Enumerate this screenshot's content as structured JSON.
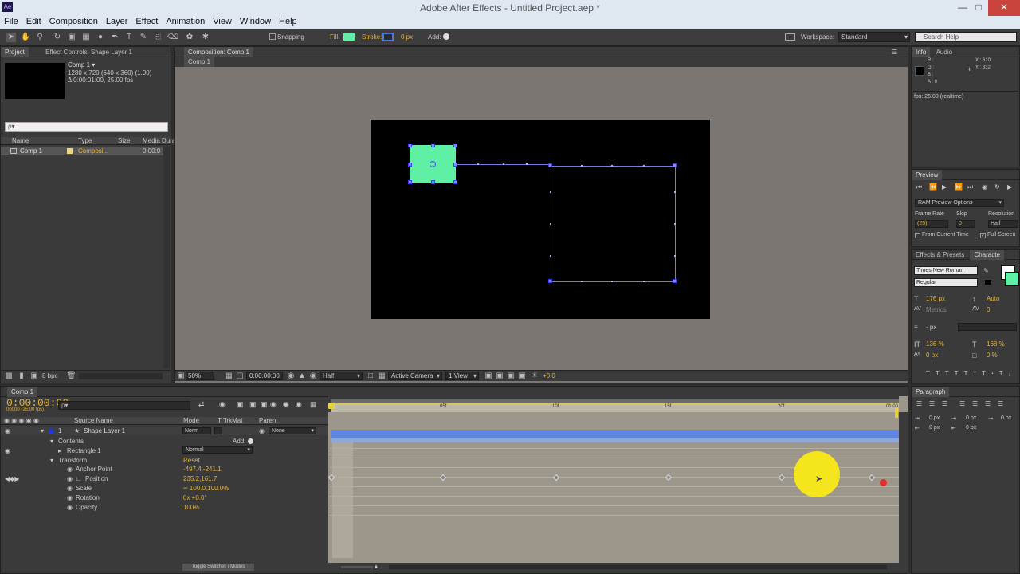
{
  "window": {
    "title": "Adobe After Effects - Untitled Project.aep *"
  },
  "menu": [
    "File",
    "Edit",
    "Composition",
    "Layer",
    "Effect",
    "Animation",
    "View",
    "Window",
    "Help"
  ],
  "toolbar": {
    "snapping": "Snapping",
    "fill": "Fill:",
    "stroke": "Stroke:",
    "stroke_px": "0 px",
    "add": "Add:",
    "workspace_label": "Workspace:",
    "workspace_value": "Standard",
    "search_placeholder": "Search Help"
  },
  "project": {
    "tab_project": "Project",
    "tab_effects": "Effect Controls: Shape Layer 1",
    "comp_name": "Comp 1 ▾",
    "comp_size": "1280 x 720 (640 x 360) (1.00)",
    "comp_dur": "Δ 0:00:01:00, 25.00 fps",
    "search_value": "ρ▾",
    "col_name": "Name",
    "col_type": "Type",
    "col_size": "Size",
    "col_media": "Media Durat",
    "item_name": "Comp 1",
    "item_type": "Composi...",
    "item_dur": "0:00:0",
    "bpc": "8 bpc"
  },
  "composition": {
    "tab": "Composition: Comp 1",
    "sub_tab": "Comp 1",
    "zoom": "50%",
    "timecode": "0:00:00:00",
    "resolution": "Half",
    "camera": "Active Camera",
    "views": "1 View",
    "offset": "+0.0"
  },
  "info": {
    "tab_info": "Info",
    "tab_audio": "Audio",
    "r": "R :",
    "g": "G :",
    "b": "B :",
    "a": "A : 0",
    "x": "X : 610",
    "y": "Y : 832",
    "fps": "fps: 25.00 (realtime)"
  },
  "preview": {
    "tab": "Preview",
    "ram": "RAM Preview Options",
    "frame_rate": "Frame Rate",
    "skip": "Skip",
    "resolution": "Resolution",
    "fr_value": "(25)",
    "skip_value": "0",
    "res_value": "Half",
    "from_current": "From Current Time",
    "full_screen": "Full Screen"
  },
  "character": {
    "tab_effects": "Effects & Presets",
    "tab_char": "Characte",
    "font": "Times New Roman",
    "style": "Regular",
    "size": "176 px",
    "leading": "Auto",
    "kerning": "Metrics",
    "tracking": "0",
    "stroke": "- px",
    "vscale": "136 %",
    "hscale": "168 %",
    "baseline": "0 px",
    "tsume": "0 %"
  },
  "paragraph": {
    "tab": "Paragraph",
    "v1": "0 px",
    "v2": "0 px",
    "v3": "0 px",
    "v4": "0 px",
    "v5": "0 px"
  },
  "timeline": {
    "tab": "Comp 1",
    "timecode": "0:00:00:00",
    "fps_line": "00000 (25.00 fps)",
    "search": "ρ▾",
    "col_source": "Source Name",
    "col_mode": "Mode",
    "col_trkmat": "T  TrkMat",
    "col_parent": "Parent",
    "layer_num": "1",
    "layer_name": "Shape Layer 1",
    "layer_mode": "Norm",
    "parent": "None",
    "contents": "Contents",
    "add": "Add:",
    "rect": "Rectangle 1",
    "rect_mode": "Normal",
    "transform": "Transform",
    "reset": "Reset",
    "anchor": "Anchor Point",
    "anchor_val": "-497.4,-241.1",
    "position": "Position",
    "position_val": "235.2,161.7",
    "scale": "Scale",
    "scale_val": "∞ 100.0,100.0%",
    "rotation": "Rotation",
    "rotation_val": "0x +0.0°",
    "opacity": "Opacity",
    "opacity_val": "100%",
    "ruler": [
      "0f",
      "05f",
      "10f",
      "15f",
      "20f",
      "01:00"
    ],
    "toggle": "Toggle Switches / Modes"
  },
  "colors": {
    "accent_yellow": "#e3b23c",
    "shape_fill": "#5ff0a6",
    "path_blue": "#7b7bd6",
    "cursor_yellow": "#f5e51c"
  }
}
